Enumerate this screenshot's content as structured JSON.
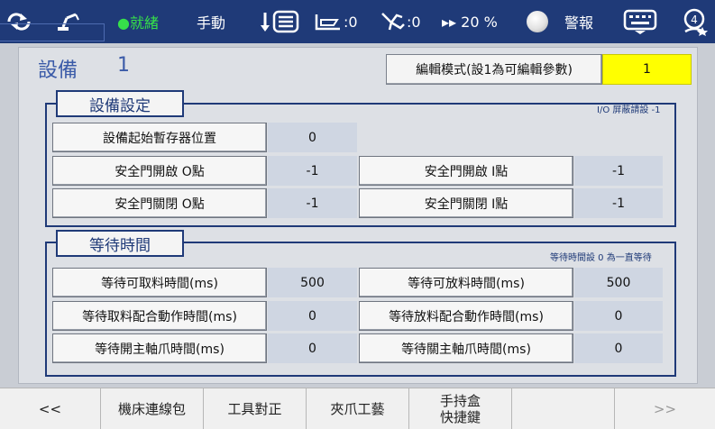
{
  "topbar": {
    "status": "●就緒",
    "mode": "手動",
    "counter1": ":0",
    "counter2": ":0",
    "speed": "▸▸ 20 %",
    "alarm": "警報"
  },
  "device": {
    "title": "設備",
    "number": "1",
    "edit_mode_label": "編輯模式(設1為可編輯參數)",
    "edit_mode_value": "1"
  },
  "equipment_settings": {
    "title": "設備設定",
    "note": "I/O 屏蔽請設 -1",
    "start_register_label": "設備起始暫存器位置",
    "start_register_value": "0",
    "rows": [
      {
        "left_label": "安全門開啟 O點",
        "left_value": "-1",
        "right_label": "安全門開啟 I點",
        "right_value": "-1"
      },
      {
        "left_label": "安全門關閉 O點",
        "left_value": "-1",
        "right_label": "安全門關閉 I點",
        "right_value": "-1"
      }
    ]
  },
  "wait_time": {
    "title": "等待時間",
    "note": "等待時間設 0 為一直等待",
    "rows": [
      {
        "left_label": "等待可取料時間(ms)",
        "left_value": "500",
        "right_label": "等待可放料時間(ms)",
        "right_value": "500"
      },
      {
        "left_label": "等待取料配合動作時間(ms)",
        "left_value": "0",
        "right_label": "等待放料配合動作時間(ms)",
        "right_value": "0"
      },
      {
        "left_label": "等待開主軸爪時間(ms)",
        "left_value": "0",
        "right_label": "等待關主軸爪時間(ms)",
        "right_value": "0"
      }
    ]
  },
  "bottombar": {
    "prev": "<<",
    "tab1": "機床連線包",
    "tab2": "工具對正",
    "tab3": "夾爪工藝",
    "tab4_line1": "手持盒",
    "tab4_line2": "快捷鍵",
    "next": ">>"
  },
  "colors": {
    "topbar": "#1f3a78",
    "ready": "#36e04a",
    "edit_value_bg": "#ffff00",
    "value_bg": "#cfd6e2"
  },
  "icons": [
    "cycle-icon",
    "robot-arm-icon",
    "program-list-icon",
    "conveyor-icon",
    "gripper-icon",
    "speed-icon",
    "keyboard-icon",
    "user-level-icon"
  ]
}
